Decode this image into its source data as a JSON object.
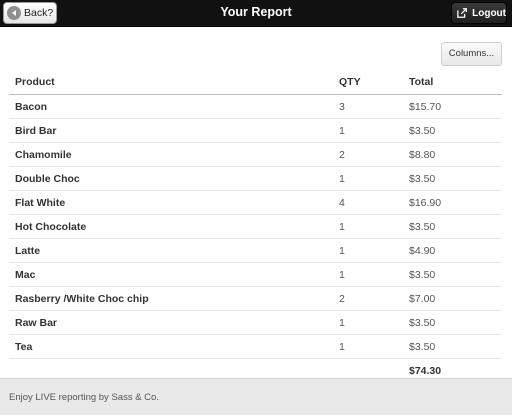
{
  "header": {
    "title": "Your Report",
    "back_label": "Back?",
    "logout_label": "Logout"
  },
  "toolbar": {
    "columns_label": "Columns..."
  },
  "table": {
    "headers": [
      "Product",
      "QTY",
      "Total"
    ],
    "rows": [
      {
        "product": "Bacon",
        "qty": "3",
        "total": "$15.70"
      },
      {
        "product": "Bird Bar",
        "qty": "1",
        "total": "$3.50"
      },
      {
        "product": "Chamomile",
        "qty": "2",
        "total": "$8.80"
      },
      {
        "product": "Double Choc",
        "qty": "1",
        "total": "$3.50"
      },
      {
        "product": "Flat White",
        "qty": "4",
        "total": "$16.90"
      },
      {
        "product": "Hot Chocolate",
        "qty": "1",
        "total": "$3.50"
      },
      {
        "product": "Latte",
        "qty": "1",
        "total": "$4.90"
      },
      {
        "product": "Mac",
        "qty": "1",
        "total": "$3.50"
      },
      {
        "product": "Rasberry /White Choc chip",
        "qty": "2",
        "total": "$7.00"
      },
      {
        "product": "Raw Bar",
        "qty": "1",
        "total": "$3.50"
      },
      {
        "product": "Tea",
        "qty": "1",
        "total": "$3.50"
      }
    ],
    "grand_total": "$74.30"
  },
  "footer": {
    "text": "Enjoy LIVE reporting by Sass & Co."
  },
  "icons": {
    "back": "back-arrow-icon",
    "logout": "logout-icon"
  },
  "colors": {
    "header_bg": "#111111",
    "footer_bg": "#e9e9e9"
  }
}
